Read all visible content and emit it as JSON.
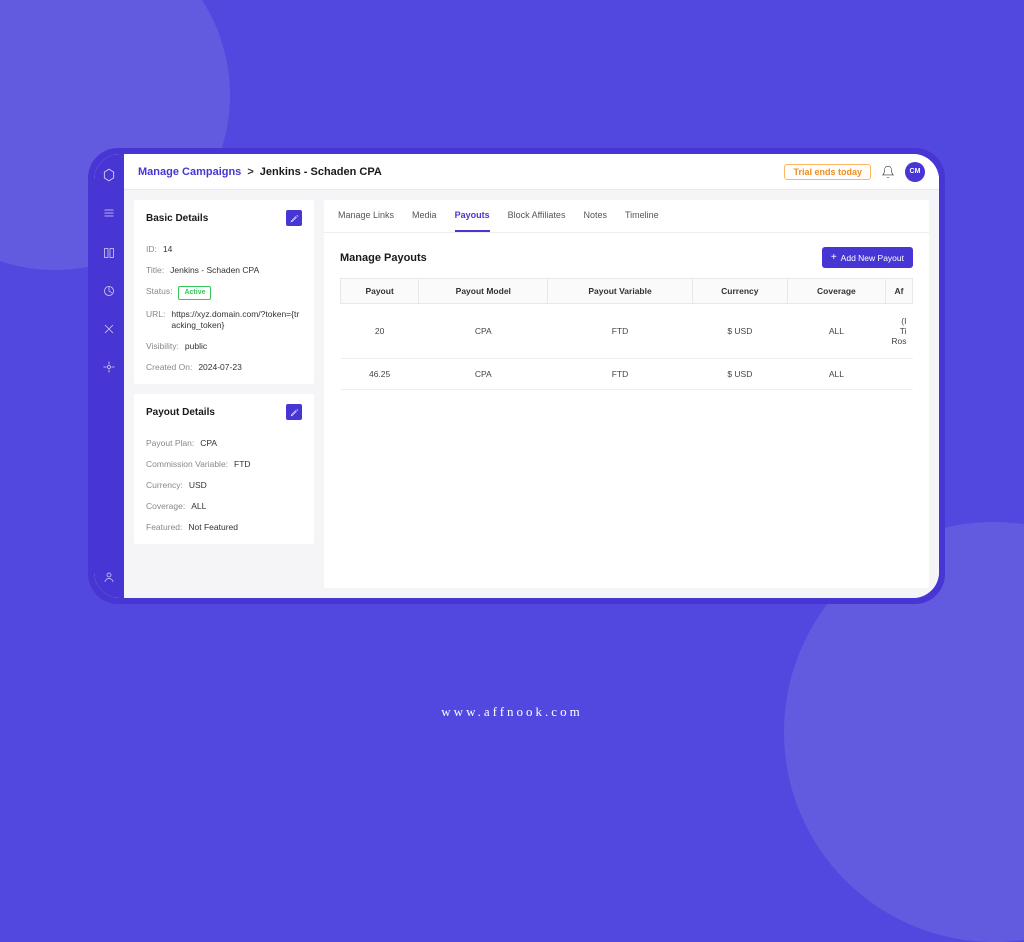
{
  "brand_url": "www.affnook.com",
  "header": {
    "breadcrumb_link": "Manage Campaigns",
    "breadcrumb_sep": ">",
    "breadcrumb_current": "Jenkins - Schaden CPA",
    "trial_badge": "Trial ends today",
    "avatar_initials": "CM"
  },
  "basic_details": {
    "title": "Basic Details",
    "id_label": "ID:",
    "id_value": "14",
    "title_label": "Title:",
    "title_value": "Jenkins - Schaden CPA",
    "status_label": "Status:",
    "status_value": "Active",
    "url_label": "URL:",
    "url_value": "https://xyz.domain.com/?token={tracking_token}",
    "visibility_label": "Visibility:",
    "visibility_value": "public",
    "created_label": "Created On:",
    "created_value": "2024-07-23"
  },
  "payout_details": {
    "title": "Payout Details",
    "plan_label": "Payout Plan:",
    "plan_value": "CPA",
    "commission_label": "Commission Variable:",
    "commission_value": "FTD",
    "currency_label": "Currency:",
    "currency_value": "USD",
    "coverage_label": "Coverage:",
    "coverage_value": "ALL",
    "featured_label": "Featured:",
    "featured_value": "Not Featured"
  },
  "tabs": {
    "manage_links": "Manage Links",
    "media": "Media",
    "payouts": "Payouts",
    "block_affiliates": "Block Affiliates",
    "notes": "Notes",
    "timeline": "Timeline"
  },
  "payouts_section": {
    "title": "Manage Payouts",
    "add_button": "Add New Payout",
    "columns": {
      "payout": "Payout",
      "payout_model": "Payout Model",
      "payout_variable": "Payout Variable",
      "currency": "Currency",
      "coverage": "Coverage",
      "affiliate": "Af"
    },
    "rows": [
      {
        "payout": "20",
        "model": "CPA",
        "variable": "FTD",
        "currency": "$ USD",
        "coverage": "ALL",
        "affiliate": "(I\nTi\nRos"
      },
      {
        "payout": "46.25",
        "model": "CPA",
        "variable": "FTD",
        "currency": "$ USD",
        "coverage": "ALL",
        "affiliate": ""
      }
    ]
  }
}
